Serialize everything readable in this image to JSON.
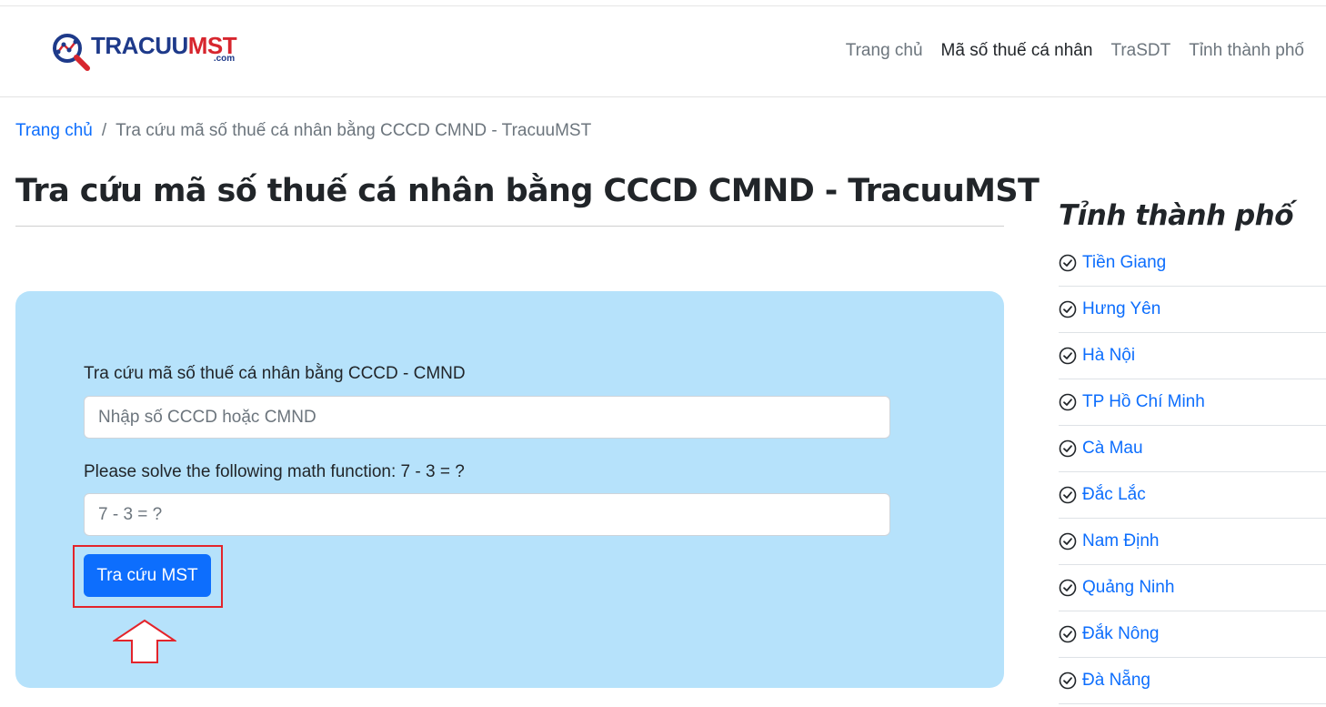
{
  "logo": {
    "text_main_a": "TRACUU",
    "text_main_b": "MST",
    "text_sub": ".com"
  },
  "nav": [
    {
      "label": "Trang chủ",
      "active": false
    },
    {
      "label": "Mã số thuế cá nhân",
      "active": true
    },
    {
      "label": "TraSDT",
      "active": false
    },
    {
      "label": "Tỉnh thành phố",
      "active": false
    }
  ],
  "breadcrumb": {
    "home": "Trang chủ",
    "separator": "/",
    "current": "Tra cứu mã số thuế cá nhân bằng CCCD CMND - TracuuMST"
  },
  "page_title": "Tra cứu mã số thuế cá nhân bằng CCCD CMND - TracuuMST",
  "form": {
    "id_label": "Tra cứu mã số thuế cá nhân bằng CCCD - CMND",
    "id_placeholder": "Nhập số CCCD hoặc CMND",
    "id_value": "",
    "math_label": "Please solve the following math function: 7 - 3 = ?",
    "math_placeholder": "7 - 3 = ?",
    "math_value": "",
    "submit_label": "Tra cứu MST"
  },
  "sidebar": {
    "title": "Tỉnh thành phố",
    "items": [
      "Tiền Giang",
      "Hưng Yên",
      "Hà Nội",
      "TP Hồ Chí Minh",
      "Cà Mau",
      "Đắc Lắc",
      "Nam Định",
      "Quảng Ninh",
      "Đắk Nông",
      "Đà Nẵng"
    ]
  },
  "colors": {
    "link": "#0d6efd",
    "panel_bg": "#b6e2fb",
    "button_bg": "#0d6efd",
    "highlight": "#e3242b",
    "logo_blue": "#1e3a8a",
    "logo_red": "#d7262e"
  },
  "icons": {
    "logo": "magnifier-chart-icon",
    "list": "check-circle-icon",
    "pointer": "up-arrow-icon"
  }
}
